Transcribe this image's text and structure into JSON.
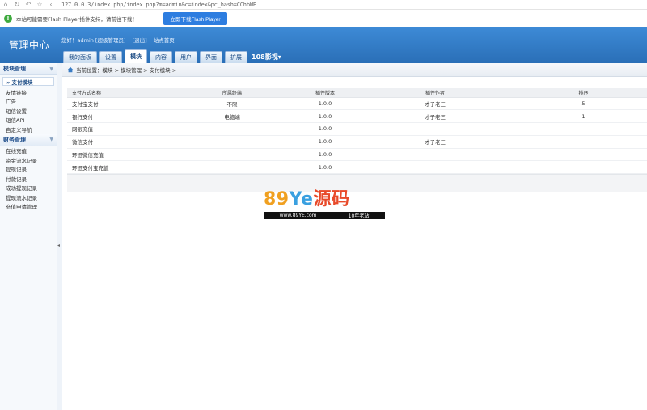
{
  "browser": {
    "url": "127.0.0.3/index.php/index.php?m=admin&c=index&pc_hash=CChbWE",
    "icons": [
      "home-icon",
      "refresh-icon",
      "undo-icon",
      "star-icon",
      "back-icon"
    ]
  },
  "notice": {
    "text": "本站可能需要Flash Player插件支持，请前往下载！",
    "button": "立即下载Flash Player"
  },
  "header": {
    "logo": "管理中心",
    "greeting": "您好！admin [超级管理员]",
    "logout": "[退出]",
    "site_home": "站点首页",
    "tabs": [
      "我的面板",
      "设置",
      "模块",
      "内容",
      "用户",
      "界面",
      "扩展"
    ],
    "active_tab": "模块",
    "site_select": "108影视▾"
  },
  "sidebar": {
    "group1": "模块管理",
    "active_item": "» 支付模块",
    "items1": [
      "友情链接",
      "广告",
      "短信设置",
      "短信API",
      "自定义导航"
    ],
    "group2": "财务管理",
    "items2": [
      "在线充值",
      "资金流水记录",
      "提现记录",
      "付款记录",
      "成功提现记录",
      "提现流水记录",
      "充值申请管理"
    ]
  },
  "breadcrumb": {
    "text": "当前位置：模块 > 模块管理 > 支付模块 >"
  },
  "table": {
    "headers": [
      "支付方式名称",
      "所属终端",
      "插件版本",
      "插件作者",
      "排序"
    ],
    "rows": [
      [
        "支付宝支付",
        "不限",
        "1.0.0",
        "才子老三",
        "5"
      ],
      [
        "银行支付",
        "电脑端",
        "1.0.0",
        "才子老三",
        "1"
      ],
      [
        "网银充值",
        "",
        "1.0.0",
        "",
        ""
      ],
      [
        "微信支付",
        "",
        "1.0.0",
        "才子老三",
        ""
      ],
      [
        "环迅微信充值",
        "",
        "1.0.0",
        "",
        ""
      ],
      [
        "环迅支付宝充值",
        "",
        "1.0.0",
        "",
        ""
      ]
    ]
  },
  "watermark": {
    "part1": "89",
    "part2": "Ye",
    "part3": "源码",
    "url": "www.89YE.com",
    "slogan": "10年老站"
  }
}
